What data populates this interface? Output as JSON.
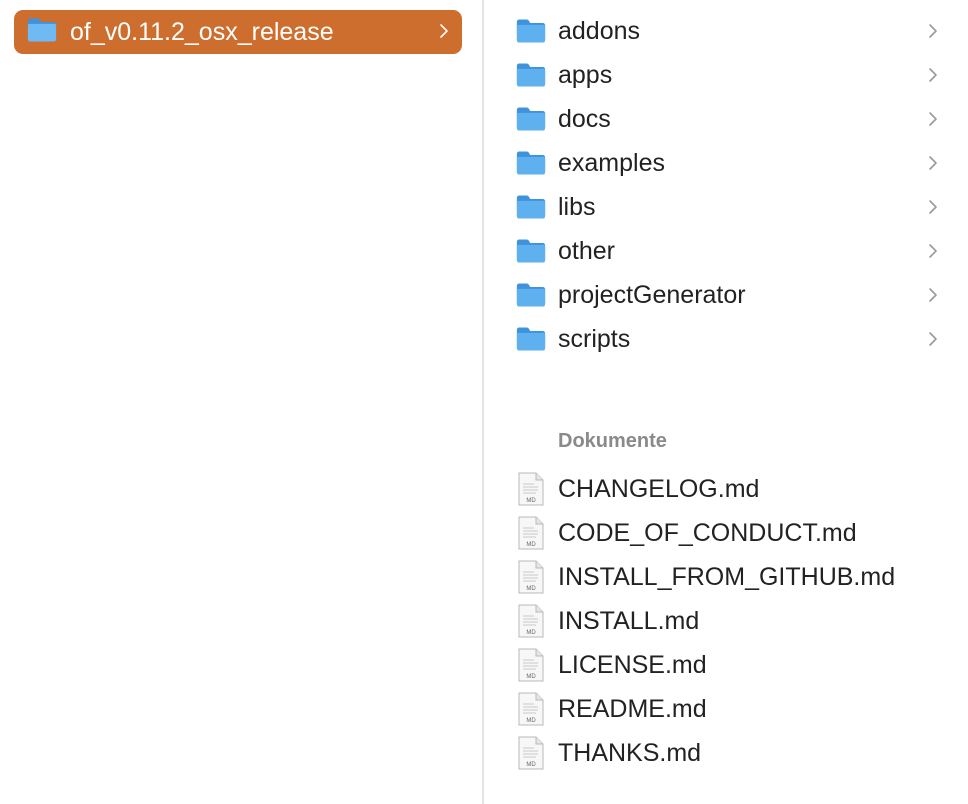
{
  "colors": {
    "selection": "#CD6E2E",
    "folder_blue": "#5EB0EE",
    "folder_tab": "#3F93DD",
    "section_header": "#8A8A8A"
  },
  "left_column": {
    "selected_folder": {
      "label": "of_v0.11.2_osx_release",
      "icon": "folder-icon"
    }
  },
  "right_column": {
    "folders": [
      {
        "label": "addons",
        "icon": "folder-icon"
      },
      {
        "label": "apps",
        "icon": "folder-icon"
      },
      {
        "label": "docs",
        "icon": "folder-icon"
      },
      {
        "label": "examples",
        "icon": "folder-icon"
      },
      {
        "label": "libs",
        "icon": "folder-icon"
      },
      {
        "label": "other",
        "icon": "folder-icon"
      },
      {
        "label": "projectGenerator",
        "icon": "folder-icon"
      },
      {
        "label": "scripts",
        "icon": "folder-icon"
      }
    ],
    "documents_header": "Dokumente",
    "file_badge": "MD",
    "documents": [
      {
        "label": "CHANGELOG.md",
        "icon": "markdown-file-icon"
      },
      {
        "label": "CODE_OF_CONDUCT.md",
        "icon": "markdown-file-icon"
      },
      {
        "label": "INSTALL_FROM_GITHUB.md",
        "icon": "markdown-file-icon"
      },
      {
        "label": "INSTALL.md",
        "icon": "markdown-file-icon"
      },
      {
        "label": "LICENSE.md",
        "icon": "markdown-file-icon"
      },
      {
        "label": "README.md",
        "icon": "markdown-file-icon"
      },
      {
        "label": "THANKS.md",
        "icon": "markdown-file-icon"
      }
    ]
  }
}
